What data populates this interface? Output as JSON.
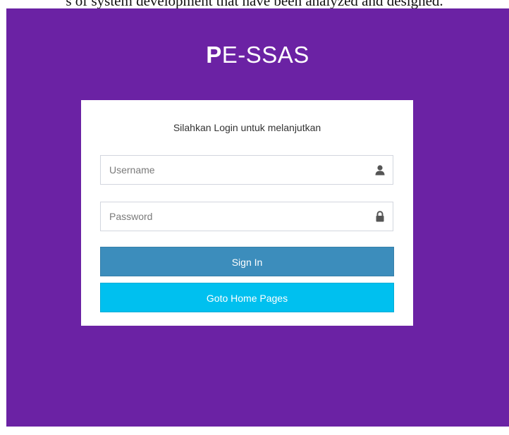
{
  "caption": "s of system development that have been analyzed and designed.",
  "brand": {
    "initial": "P",
    "rest": "E-SSAS"
  },
  "login": {
    "message": "Silahkan Login untuk melanjutkan",
    "username": {
      "placeholder": "Username",
      "value": "",
      "icon": "user-icon"
    },
    "password": {
      "placeholder": "Password",
      "value": "",
      "icon": "lock-icon"
    },
    "signin_label": "Sign In",
    "home_label": "Goto Home Pages"
  },
  "colors": {
    "background": "#6b22a4",
    "signin_button": "#3c8dbc",
    "home_button": "#00c0ef"
  }
}
